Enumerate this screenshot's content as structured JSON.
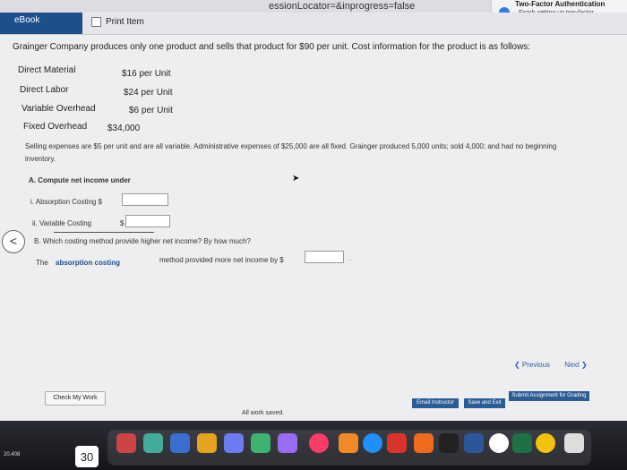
{
  "browser": {
    "url_fragment": "essionLocator=&inprogress=false",
    "notification": {
      "title": "Two-Factor Authentication",
      "body": "Finish setting up two-factor authentication on this Mac."
    }
  },
  "toolbar": {
    "ebook_label": "eBook",
    "print_label": "Print Item"
  },
  "problem": {
    "intro": "Grainger Company produces only one product and sells that product for $90 per unit. Cost information for the product is as follows:",
    "costs": [
      {
        "label": "Direct Material",
        "value": "$16 per Unit"
      },
      {
        "label": "Direct Labor",
        "value": "$24 per Unit"
      },
      {
        "label": "Variable Overhead",
        "value": "$6 per Unit"
      },
      {
        "label": "Fixed Overhead",
        "value": "$34,000"
      }
    ],
    "selling_line1": "Selling expenses are $5 per unit and are all variable. Administrative expenses of $25,000 are all fixed. Grainger produced 5,000 units; sold 4,000; and had no beginning",
    "selling_line2": "inventory.",
    "part_a": "A. Compute net income under",
    "absorption_label": "i. Absorption Costing $",
    "variable_label": "ii. Variable Costing",
    "variable_dollar": "$",
    "part_b": "B. Which costing method provide higher net income? By how much?",
    "answer_prefix": "The",
    "answer_selection": "absorption costing",
    "answer_suffix": "method provided more net income by $",
    "period": "."
  },
  "navigation": {
    "previous": "Previous",
    "next": "Next",
    "back_chevron": "<"
  },
  "footer": {
    "check_my_work": "Check My Work",
    "email_instructor": "Email Instructor",
    "save_and_exit": "Save and Exit",
    "submit": "Submit Assignment for Grading",
    "status": "All work saved."
  },
  "dock": {
    "calendar_day": "30",
    "clock": "20,408"
  }
}
